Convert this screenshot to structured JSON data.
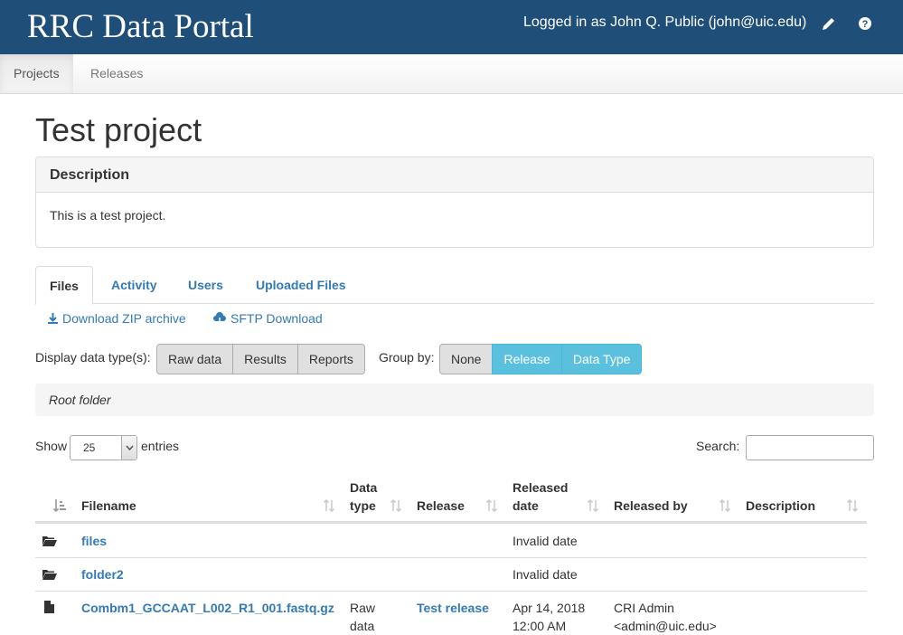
{
  "header": {
    "app_title": "RRC Data Portal",
    "user_text": "Logged in as John Q. Public (john@uic.edu)",
    "icons": [
      "pencil-icon",
      "help-icon"
    ]
  },
  "nav": {
    "tabs": [
      {
        "label": "Projects",
        "active": true
      },
      {
        "label": "Releases",
        "active": false
      }
    ]
  },
  "page_title": "Test project",
  "description_panel": {
    "heading": "Description",
    "body": "This is a test project."
  },
  "content_tabs": [
    "Files",
    "Activity",
    "Users",
    "Uploaded Files"
  ],
  "downloads": {
    "zip": "Download ZIP archive",
    "sftp": "SFTP Download"
  },
  "filters": {
    "data_type_label": "Display data type(s):",
    "data_types": [
      "Raw data",
      "Results",
      "Reports"
    ],
    "group_by_label": "Group by:",
    "group_options": [
      {
        "label": "None",
        "active": false
      },
      {
        "label": "Release",
        "active": true
      },
      {
        "label": "Data Type",
        "active": true
      }
    ]
  },
  "breadcrumb": "Root folder",
  "table_controls": {
    "show_label": "Show",
    "page_size": "25",
    "entries_label": "entries",
    "search_label": "Search:"
  },
  "table": {
    "columns": [
      "Filename",
      "Data type",
      "Release",
      "Released date",
      "Released by",
      "Description"
    ],
    "rows": [
      {
        "icon": "folder-open-icon",
        "filename": "files",
        "data_type": "",
        "release": "",
        "released_date": "Invalid date",
        "released_by": "",
        "description": ""
      },
      {
        "icon": "folder-open-icon",
        "filename": "folder2",
        "data_type": "",
        "release": "",
        "released_date": "Invalid date",
        "released_by": "",
        "description": ""
      },
      {
        "icon": "file-icon",
        "filename": "Combm1_GCCAAT_L002_R1_001.fastq.gz",
        "data_type": "Raw data",
        "release": "Test release",
        "released_date": "Apr 14, 2018 12:00 AM",
        "released_by": "CRI Admin <admin@uic.edu>",
        "description": ""
      }
    ]
  },
  "colors": {
    "header_bg": "#1f4e79",
    "link": "#337ab7",
    "active_toggle": "#5bc0de"
  }
}
